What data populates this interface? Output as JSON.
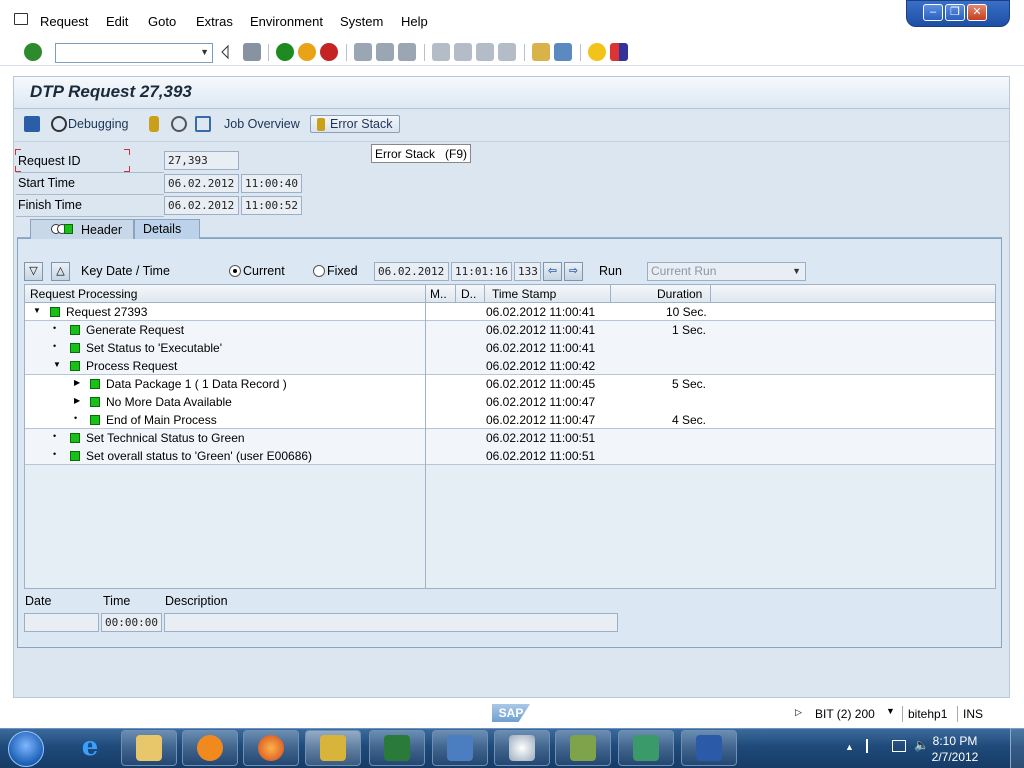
{
  "window": {
    "minimize": "–",
    "restore": "❐",
    "close": "✕"
  },
  "menu": [
    "Request",
    "Edit",
    "Goto",
    "Extras",
    "Environment",
    "System",
    "Help"
  ],
  "toolbar": {
    "command_value": ""
  },
  "title": "DTP Request 27,393",
  "app_toolbar": {
    "debugging": "Debugging",
    "job_overview": "Job Overview",
    "error_stack": "Error Stack"
  },
  "tooltip": "Error Stack   (F9)",
  "header_fields": {
    "request_id_label": "Request ID",
    "request_id": "27,393",
    "start_label": "Start Time",
    "start_date": "06.02.2012",
    "start_time": "11:00:40",
    "finish_label": "Finish Time",
    "finish_date": "06.02.2012",
    "finish_time": "11:00:52"
  },
  "tabs": {
    "header": "Header",
    "details": "Details"
  },
  "details": {
    "key_date_label": "Key Date / Time",
    "current": "Current",
    "fixed": "Fixed",
    "date": "06.02.2012",
    "time": "11:01:16",
    "num": "133",
    "run_label": "Run",
    "run_value": "Current Run"
  },
  "tree": {
    "columns": {
      "processing": "Request Processing",
      "m": "M..",
      "d": "D..",
      "timestamp": "Time Stamp",
      "duration": "Duration"
    },
    "rows": [
      {
        "label": "Request 27393",
        "ts": "06.02.2012 11:00:41",
        "dur": "10 Sec."
      },
      {
        "label": "Generate Request",
        "ts": "06.02.2012 11:00:41",
        "dur": "1 Sec."
      },
      {
        "label": "Set Status to 'Executable'",
        "ts": "06.02.2012 11:00:41",
        "dur": ""
      },
      {
        "label": "Process Request",
        "ts": "06.02.2012 11:00:42",
        "dur": ""
      },
      {
        "label": "Data Package 1 ( 1 Data Record )",
        "ts": "06.02.2012 11:00:45",
        "dur": "5 Sec."
      },
      {
        "label": "No More Data Available",
        "ts": "06.02.2012 11:00:47",
        "dur": ""
      },
      {
        "label": "End of Main Process",
        "ts": "06.02.2012 11:00:47",
        "dur": "4 Sec."
      },
      {
        "label": "Set Technical Status to Green",
        "ts": "06.02.2012 11:00:51",
        "dur": ""
      },
      {
        "label": "Set overall status to 'Green' (user E00686)",
        "ts": "06.02.2012 11:00:51",
        "dur": ""
      }
    ]
  },
  "log": {
    "date_label": "Date",
    "time_label": "Time",
    "desc_label": "Description",
    "date": "",
    "time": "00:00:00",
    "desc": ""
  },
  "status": {
    "system": "BIT (2) 200",
    "host": "bitehp1",
    "mode": "INS",
    "logo": "SAP"
  },
  "taskbar": {
    "time": "8:10 PM",
    "date": "2/7/2012"
  }
}
